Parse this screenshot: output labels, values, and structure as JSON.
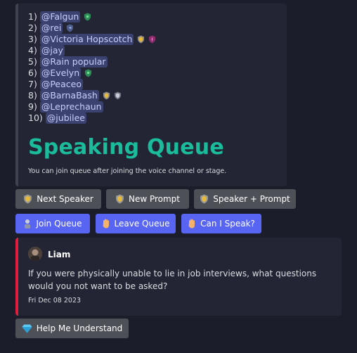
{
  "queue": {
    "entries": [
      {
        "num": "1)",
        "name": "@Falgun",
        "badges": [
          "green-shield-icon"
        ]
      },
      {
        "num": "2)",
        "name": "@rei",
        "badges": [
          "blue-shield-icon"
        ]
      },
      {
        "num": "3)",
        "name": "@Victoria Hopscotch",
        "badges": [
          "gold-shield-icon",
          "pink-shield-icon"
        ]
      },
      {
        "num": "4)",
        "name": "@jay",
        "badges": []
      },
      {
        "num": "5)",
        "name": "@Rain popular",
        "badges": []
      },
      {
        "num": "6)",
        "name": "@Evelyn",
        "badges": [
          "green-shield-icon"
        ]
      },
      {
        "num": "7)",
        "name": "@Peaceo",
        "badges": []
      },
      {
        "num": "8)",
        "name": "@BarnaBash",
        "badges": [
          "gold-shield-icon",
          "silver-shield-icon"
        ]
      },
      {
        "num": "9)",
        "name": "@Leprechaun",
        "badges": []
      },
      {
        "num": "10)",
        "name": "@jubilee",
        "badges": []
      }
    ],
    "heading": "Speaking Queue",
    "note": "You can join queue after joining the voice channel or stage."
  },
  "buttons": {
    "next_speaker": "Next Speaker",
    "new_prompt": "New Prompt",
    "speaker_prompt": "Speaker + Prompt",
    "join_queue": "Join Queue",
    "leave_queue": "Leave Queue",
    "can_i_speak": "Can I Speak?",
    "help_me_understand": "Help Me Understand"
  },
  "prompt": {
    "author": "Liam",
    "question": "If you were physically unable to lie in job interviews, what questions would you not want to be asked?",
    "date": "Fri Dec 08 2023"
  },
  "colors": {
    "queue_heading": "#1abc9c",
    "prompt_accent": "#e01e3c",
    "blurple": "#5865f2",
    "grey_button": "#4e5058"
  }
}
